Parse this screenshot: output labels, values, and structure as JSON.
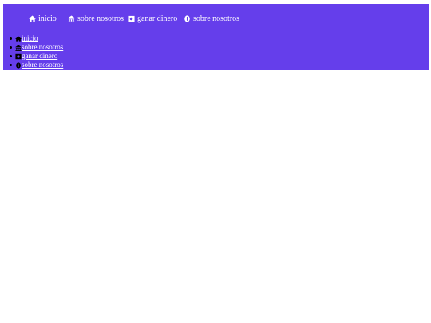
{
  "nav": [
    {
      "label": "inicio",
      "icon": "home-icon"
    },
    {
      "label": "sobre nosotros",
      "icon": "building-icon"
    },
    {
      "label": "ganar dinero",
      "icon": "money-icon"
    },
    {
      "label": "sobre nosotros",
      "icon": "info-icon"
    }
  ],
  "list": [
    {
      "label": "inicio",
      "icon": "home-icon"
    },
    {
      "label": "sobre nosotros",
      "icon": "building-icon"
    },
    {
      "label": "ganar dinero",
      "icon": "money-icon"
    },
    {
      "label": "sobre nosotros",
      "icon": "info-icon"
    }
  ],
  "colors": {
    "header_bg": "#653eeb",
    "link": "#ffffff",
    "list_icon": "#000000"
  }
}
